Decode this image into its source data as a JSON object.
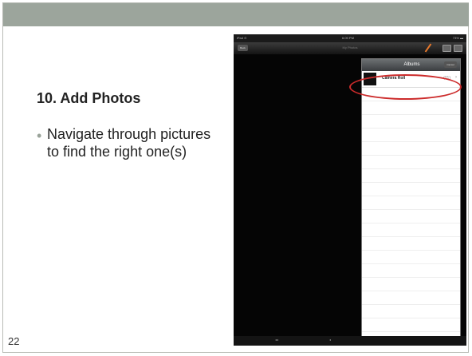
{
  "slide": {
    "heading": "10. Add Photos",
    "bullet": "Navigate through pictures to find the right one(s)",
    "page_number": "22"
  },
  "ipad": {
    "status_left": "iPad ⊙",
    "status_time": "6:09 PM",
    "status_right": "73% ▬",
    "back_label": "Back",
    "nav_title": "My Photos",
    "toolbar_a": "◂◂",
    "toolbar_b": "◂",
    "popover": {
      "title": "Albums",
      "cancel_label": "Cancel",
      "albums": [
        {
          "name": "Camera Roll",
          "count": "(21)"
        }
      ]
    }
  },
  "colors": {
    "title_bar": "#9ca59c",
    "highlight": "#cc2b2b",
    "pencil": "#e8792c"
  }
}
